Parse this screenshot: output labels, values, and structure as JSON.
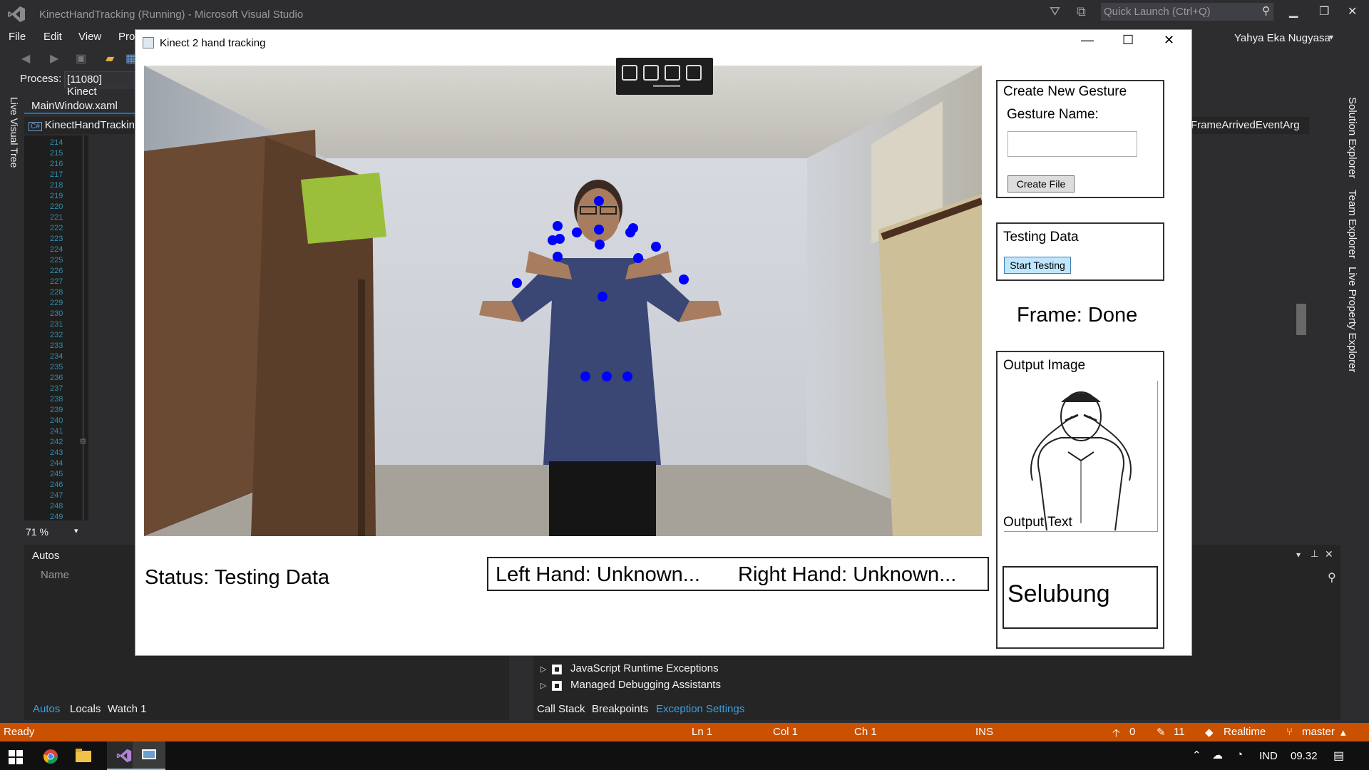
{
  "vs": {
    "title": "KinectHandTracking (Running) - Microsoft Visual Studio",
    "quick_launch_placeholder": "Quick Launch (Ctrl+Q)",
    "user": "Yahya Eka Nugyasa",
    "menu": [
      "File",
      "Edit",
      "View",
      "Pro"
    ],
    "process_label": "Process:",
    "process_value": "[11080] Kinect",
    "side_tab": "Live Visual Tree",
    "editor_tab": "MainWindow.xaml",
    "nav_left": "KinectHandTrackin",
    "nav_right": "FrameArrivedEventArg",
    "line_numbers": [
      "214",
      "215",
      "216",
      "217",
      "218",
      "219",
      "220",
      "221",
      "222",
      "223",
      "224",
      "225",
      "226",
      "227",
      "228",
      "229",
      "230",
      "231",
      "232",
      "233",
      "234",
      "235",
      "236",
      "237",
      "238",
      "239",
      "240",
      "241",
      "242",
      "243",
      "244",
      "245",
      "246",
      "247",
      "248",
      "249"
    ],
    "zoom": "71 %",
    "right_strip": [
      "Solution Explorer",
      "Team Explorer",
      "Live Property Explorer"
    ],
    "autos": {
      "title": "Autos",
      "name_col": "Name",
      "tabs": [
        "Autos",
        "Locals",
        "Watch 1"
      ]
    },
    "exceptions": {
      "rows": [
        "JavaScript Runtime Exceptions",
        "Managed Debugging Assistants"
      ],
      "tabs": [
        "Call Stack",
        "Breakpoints",
        "Exception Settings"
      ]
    },
    "status_bar": {
      "ready": "Ready",
      "ln": "Ln 1",
      "col": "Col 1",
      "ch": "Ch 1",
      "ins": "INS",
      "up_count": "0",
      "edit_count": "11",
      "realtime": "Realtime",
      "branch": "master"
    },
    "tray": {
      "lang": "IND",
      "time": "09.32"
    },
    "accent": "#007acc",
    "status_color": "#ca5100"
  },
  "app": {
    "title": "Kinect 2 hand tracking",
    "status": "Status: Testing Data",
    "left_hand": "Left Hand: Unknown...",
    "right_hand": "Right Hand: Unknown...",
    "create_gesture": {
      "title": "Create New Gesture",
      "name_label": "Gesture Name:",
      "name_value": "",
      "button": "Create File"
    },
    "testing": {
      "title": "Testing Data",
      "button": "Start Testing"
    },
    "frame": "Frame: Done",
    "output_image_title": "Output Image",
    "output_text_title": "Output Text",
    "output_text": "Selubung",
    "joint_color": "#0000ff"
  }
}
